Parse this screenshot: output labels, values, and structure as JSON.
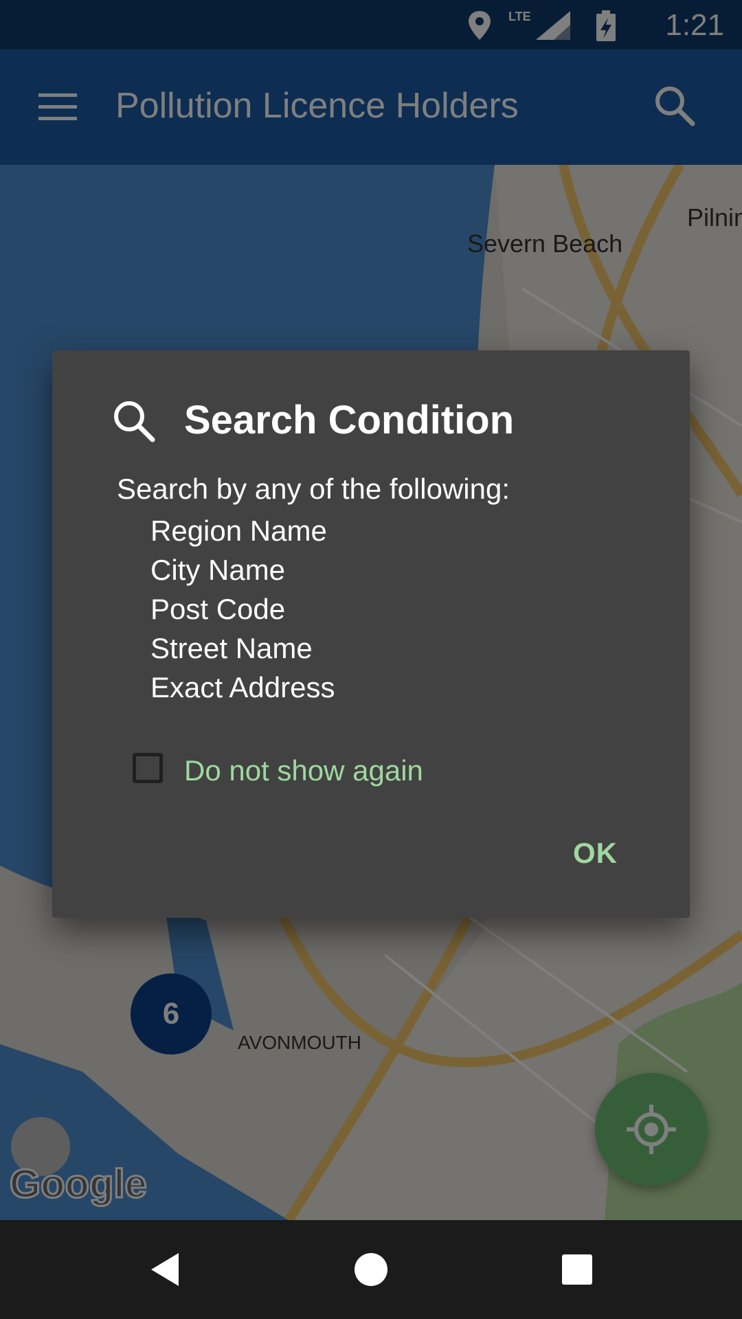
{
  "status_bar": {
    "time": "1:21",
    "network": "LTE",
    "icons": [
      "location-icon",
      "lte-signal-icon",
      "battery-charging-icon"
    ]
  },
  "app_bar": {
    "title": "Pollution Licence Holders",
    "icons": [
      "menu-icon",
      "search-icon"
    ]
  },
  "map": {
    "labels": [
      "Severn Beach",
      "Pilnin",
      "AVONMOUTH"
    ],
    "cluster_count": "6",
    "attribution": "Google",
    "icons": [
      "my-location-icon"
    ]
  },
  "dialog": {
    "icon": "search-icon",
    "title": "Search Condition",
    "intro": "Search by any of the following:",
    "options": [
      "Region Name",
      "City Name",
      "Post Code",
      "Street Name",
      "Exact Address"
    ],
    "checkbox_label": "Do not show again",
    "checkbox_checked": false,
    "ok_label": "OK"
  },
  "nav_bar": {
    "icons": [
      "back-icon",
      "home-icon",
      "recents-icon"
    ]
  }
}
